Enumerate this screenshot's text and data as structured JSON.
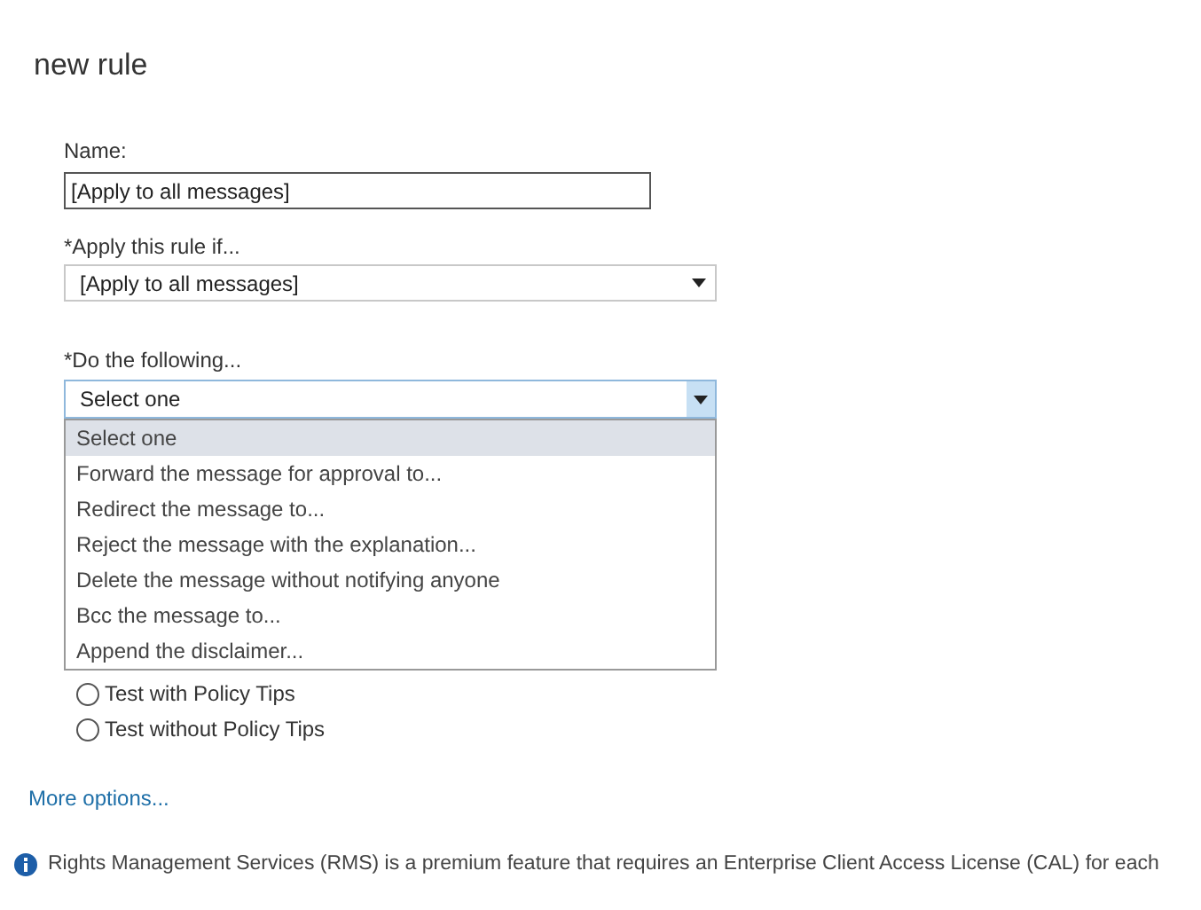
{
  "title": "new rule",
  "name_field": {
    "label": "Name:",
    "value": "[Apply to all messages]"
  },
  "condition": {
    "label": "*Apply this rule if...",
    "value": "[Apply to all messages]"
  },
  "action": {
    "label": "*Do the following...",
    "value": "Select one",
    "expanded": true,
    "options": [
      {
        "label": "Select one",
        "selected": true
      },
      {
        "label": "Forward the message for approval to...",
        "selected": false
      },
      {
        "label": "Redirect the message to...",
        "selected": false
      },
      {
        "label": "Reject the message with the explanation...",
        "selected": false
      },
      {
        "label": "Delete the message without notifying anyone",
        "selected": false
      },
      {
        "label": "Bcc the message to...",
        "selected": false
      },
      {
        "label": "Append the disclaimer...",
        "selected": false
      }
    ]
  },
  "modes": [
    {
      "label": "Test with Policy Tips",
      "selected": false
    },
    {
      "label": "Test without Policy Tips",
      "selected": false
    }
  ],
  "more_options": "More options...",
  "info": "Rights Management Services (RMS) is a premium feature that requires an Enterprise Client Access License (CAL) for each"
}
